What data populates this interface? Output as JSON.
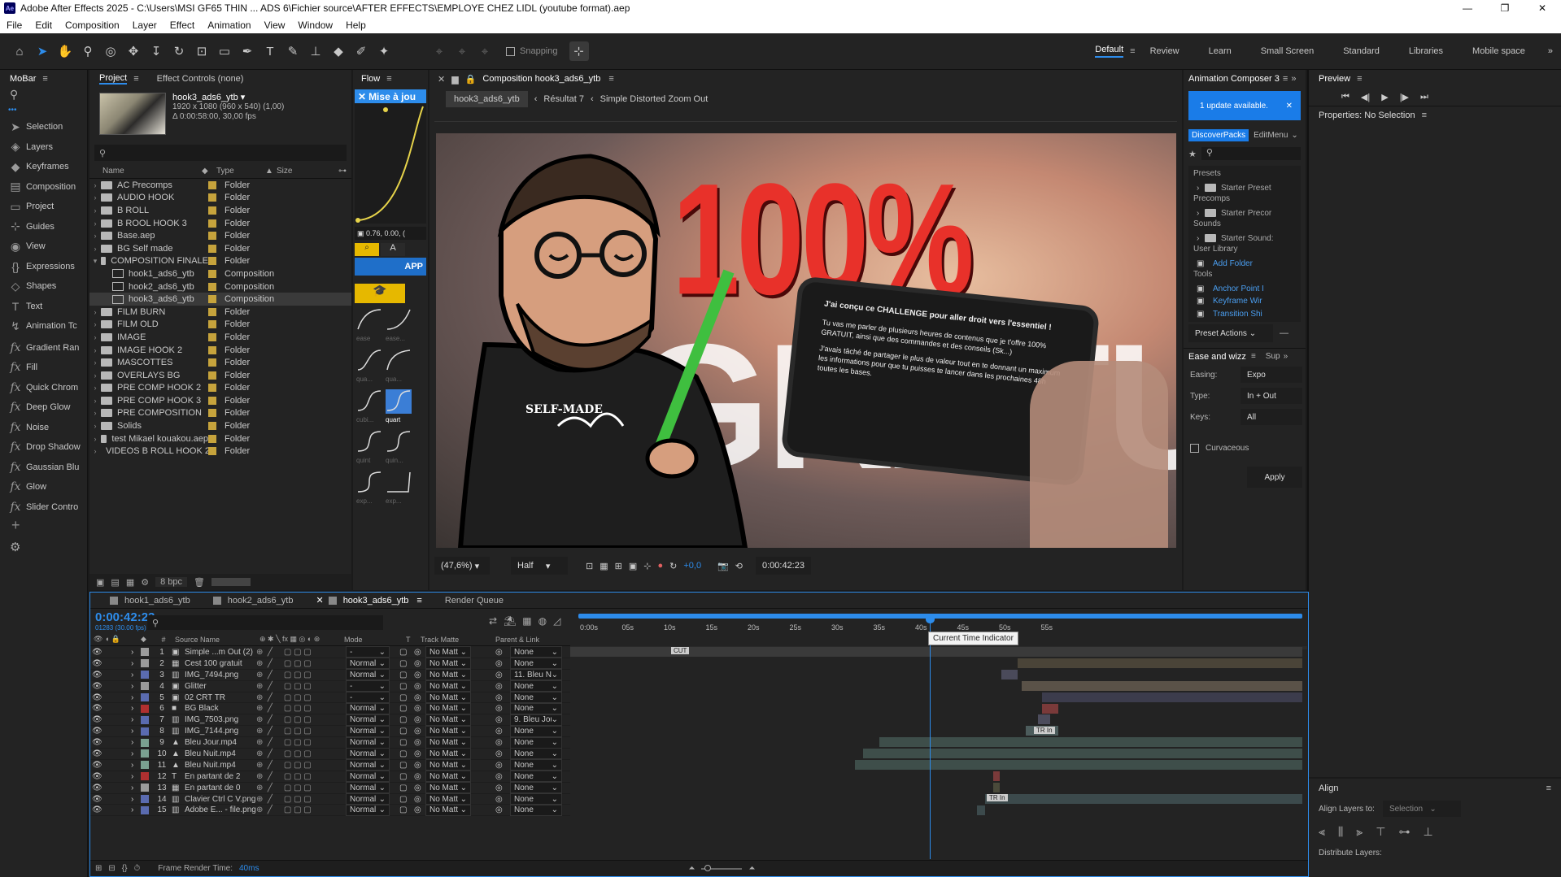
{
  "app": {
    "title": "Adobe After Effects 2025 - C:\\Users\\MSI GF65 THIN ... ADS 6\\Fichier source\\AFTER EFFECTS\\EMPLOYE CHEZ LIDL (youtube format).aep",
    "logo": "Ae"
  },
  "menu": [
    "File",
    "Edit",
    "Composition",
    "Layer",
    "Effect",
    "Animation",
    "View",
    "Window",
    "Help"
  ],
  "toolbar": {
    "snapping": "Snapping",
    "workspaces": [
      "Default",
      "Review",
      "Learn",
      "Small Screen",
      "Standard",
      "Libraries",
      "Mobile space"
    ]
  },
  "mobar": {
    "title": "MoBar",
    "items": [
      {
        "icon": "cursor-icon",
        "label": "Selection"
      },
      {
        "icon": "layers-icon",
        "label": "Layers"
      },
      {
        "icon": "keyframes-icon",
        "label": "Keyframes"
      },
      {
        "icon": "composition-icon",
        "label": "Composition"
      },
      {
        "icon": "project-icon",
        "label": "Project"
      },
      {
        "icon": "guides-icon",
        "label": "Guides"
      },
      {
        "icon": "eye-icon",
        "label": "View"
      },
      {
        "icon": "expressions-icon",
        "label": "Expressions"
      },
      {
        "icon": "shapes-icon",
        "label": "Shapes"
      },
      {
        "icon": "text-icon",
        "label": "Text"
      },
      {
        "icon": "animation-icon",
        "label": "Animation Tc"
      }
    ],
    "fx": [
      "Gradient Ran",
      "Fill",
      "Quick Chrom",
      "Deep Glow",
      "Noise",
      "Drop Shadow",
      "Gaussian Blu",
      "Glow",
      "Slider Contro"
    ]
  },
  "project": {
    "tab": "Project",
    "tab2": "Effect Controls (none)",
    "item_name": "hook3_ads6_ytb",
    "item_info1": "1920 x 1080  (960 x 540) (1,00)",
    "item_info2": "Δ 0:00:58:00, 30,00 fps",
    "headers": {
      "name": "Name",
      "type": "Type",
      "size": "Size"
    },
    "bpc": "8 bpc",
    "rows": [
      {
        "name": "AC Precomps",
        "type": "Folder",
        "indent": 0,
        "kind": "folder"
      },
      {
        "name": "AUDIO HOOK",
        "type": "Folder",
        "indent": 0,
        "kind": "folder"
      },
      {
        "name": "B ROLL",
        "type": "Folder",
        "indent": 0,
        "kind": "folder"
      },
      {
        "name": "B ROOL HOOK 3",
        "type": "Folder",
        "indent": 0,
        "kind": "folder"
      },
      {
        "name": "Base.aep",
        "type": "Folder",
        "indent": 0,
        "kind": "folder"
      },
      {
        "name": "BG Self made",
        "type": "Folder",
        "indent": 0,
        "kind": "folder"
      },
      {
        "name": "COMPOSITION FINALE",
        "type": "Folder",
        "indent": 0,
        "kind": "folder-open"
      },
      {
        "name": "hook1_ads6_ytb",
        "type": "Composition",
        "indent": 1,
        "kind": "comp"
      },
      {
        "name": "hook2_ads6_ytb",
        "type": "Composition",
        "indent": 1,
        "kind": "comp"
      },
      {
        "name": "hook3_ads6_ytb",
        "type": "Composition",
        "indent": 1,
        "kind": "comp",
        "selected": true
      },
      {
        "name": "FILM BURN",
        "type": "Folder",
        "indent": 0,
        "kind": "folder"
      },
      {
        "name": "FILM OLD",
        "type": "Folder",
        "indent": 0,
        "kind": "folder"
      },
      {
        "name": "IMAGE",
        "type": "Folder",
        "indent": 0,
        "kind": "folder"
      },
      {
        "name": "IMAGE HOOK 2",
        "type": "Folder",
        "indent": 0,
        "kind": "folder"
      },
      {
        "name": "MASCOTTES",
        "type": "Folder",
        "indent": 0,
        "kind": "folder"
      },
      {
        "name": "OVERLAYS BG",
        "type": "Folder",
        "indent": 0,
        "kind": "folder"
      },
      {
        "name": "PRE COMP HOOK 2",
        "type": "Folder",
        "indent": 0,
        "kind": "folder"
      },
      {
        "name": "PRE COMP HOOK 3",
        "type": "Folder",
        "indent": 0,
        "kind": "folder"
      },
      {
        "name": "PRE COMPOSITION",
        "type": "Folder",
        "indent": 0,
        "kind": "folder"
      },
      {
        "name": "Solids",
        "type": "Folder",
        "indent": 0,
        "kind": "folder"
      },
      {
        "name": "test Mikael kouakou.aep",
        "type": "Folder",
        "indent": 0,
        "kind": "folder"
      },
      {
        "name": "VIDEOS B ROLL HOOK 2",
        "type": "Folder",
        "indent": 0,
        "kind": "folder"
      }
    ]
  },
  "flow": {
    "tab": "Flow",
    "banner": "Mise à jou",
    "value": "0.76, 0.00, (",
    "app": "APP",
    "ease_labels": [
      "ease",
      "ease...",
      "qua...",
      "qua...",
      "cubi...",
      "quart",
      "quint",
      "quin...",
      "exp...",
      "exp..."
    ]
  },
  "viewer": {
    "tab": "Composition hook3_ads6_ytb",
    "crumbs": [
      "hook3_ads6_ytb",
      "Résultat 7",
      "Simple Distorted Zoom Out"
    ],
    "big_text": "100%",
    "overlay_text": "GRATUIT",
    "shirt": "SELF-MADE",
    "phone_text": "J'ai conçu ce CHALLENGE pour aller droit vers l'essentiel !",
    "phone_body": "Tu vas me parler de plusieurs heures de contenus que je t'offre 100% GRATUIT, ainsi que des commandes et des conseils (Sk...)",
    "phone_body2": "J'avais tâché de partager le plus de valeur tout en te donnant un maximum les informations pour que tu puisses te lancer dans les prochaines 48h toutes les bases.",
    "zoom": "(47,6%)",
    "res": "Half",
    "exposure": "+0,0",
    "timecode": "0:00:42:23"
  },
  "anim": {
    "tab": "Animation Composer 3",
    "update": "1 update available.",
    "subtabs": [
      "DiscoverPacks",
      "EditMenu"
    ],
    "sections": [
      {
        "title": "Presets",
        "items": [
          {
            "label": "Starter Preset",
            "type": "folder"
          }
        ]
      },
      {
        "title": "Precomps",
        "items": [
          {
            "label": "Starter Precor",
            "type": "folder"
          }
        ]
      },
      {
        "title": "Sounds",
        "items": [
          {
            "label": "Starter Sound:",
            "type": "folder"
          }
        ]
      },
      {
        "title": "User Library",
        "items": [
          {
            "label": "Add Folder",
            "type": "link"
          }
        ]
      },
      {
        "title": "Tools",
        "items": [
          {
            "label": "Anchor Point I",
            "type": "link"
          },
          {
            "label": "Keyframe Wir",
            "type": "link"
          },
          {
            "label": "Transition Shi",
            "type": "link"
          }
        ]
      }
    ],
    "preset_actions": "Preset Actions",
    "ease_tab": "Ease and wizz",
    "sup_tab": "Sup",
    "easing_label": "Easing:",
    "easing": "Expo",
    "type_label": "Type:",
    "type": "In + Out",
    "keys_label": "Keys:",
    "keys": "All",
    "curvaceous": "Curvaceous",
    "apply": "Apply"
  },
  "preview": {
    "tab": "Preview",
    "properties": "Properties: No Selection",
    "align_title": "Align",
    "align_layers_to": "Align Layers to:",
    "selection": "Selection",
    "distribute": "Distribute Layers:"
  },
  "timeline": {
    "tabs": [
      "hook1_ads6_ytb",
      "hook2_ads6_ytb",
      "hook3_ads6_ytb",
      "Render Queue"
    ],
    "timecode": "0:00:42:23",
    "frames": "01283 (30.00 fps)",
    "ruler": [
      "0:00s",
      "05s",
      "10s",
      "15s",
      "20s",
      "25s",
      "30s",
      "35s",
      "40s",
      "45s",
      "50s",
      "55s"
    ],
    "headers": {
      "num": "#",
      "src": "Source Name",
      "mode": "Mode",
      "t": "T",
      "matte": "Track Matte",
      "parent": "Parent & Link"
    },
    "tooltip": "Current Time Indicator",
    "cut": "CUT",
    "trin": "TR In",
    "render_time_label": "Frame Render Time:",
    "render_time": "40ms",
    "layers": [
      {
        "n": "1",
        "name": "Simple ...m Out (2)",
        "mode": "-",
        "matte": "No Matt",
        "parent": "None",
        "color": "#9b9b9b",
        "icon": "adj"
      },
      {
        "n": "2",
        "name": "Cest 100 gratuit",
        "mode": "Normal",
        "matte": "No Matt",
        "parent": "None",
        "color": "#9b9b9b",
        "icon": "comp"
      },
      {
        "n": "3",
        "name": "IMG_7494.png",
        "mode": "Normal",
        "matte": "No Matt",
        "parent": "11. Bleu Nu",
        "color": "#5a6bb0",
        "icon": "img"
      },
      {
        "n": "4",
        "name": "Glitter",
        "mode": "-",
        "matte": "No Matt",
        "parent": "None",
        "color": "#9b9b9b",
        "icon": "adj"
      },
      {
        "n": "5",
        "name": "02 CRT TR",
        "mode": "-",
        "matte": "No Matt",
        "parent": "None",
        "color": "#5a6bb0",
        "icon": "adj"
      },
      {
        "n": "6",
        "name": "BG Black",
        "mode": "Normal",
        "matte": "No Matt",
        "parent": "None",
        "color": "#b03030",
        "icon": "solid"
      },
      {
        "n": "7",
        "name": "IMG_7503.png",
        "mode": "Normal",
        "matte": "No Matt",
        "parent": "9. Bleu Jour.",
        "color": "#5a6bb0",
        "icon": "img"
      },
      {
        "n": "8",
        "name": "IMG_7144.png",
        "mode": "Normal",
        "matte": "No Matt",
        "parent": "None",
        "color": "#5a6bb0",
        "icon": "img"
      },
      {
        "n": "9",
        "name": "Bleu Jour.mp4",
        "mode": "Normal",
        "matte": "No Matt",
        "parent": "None",
        "color": "#7aa090",
        "icon": "video"
      },
      {
        "n": "10",
        "name": "Bleu Nuit.mp4",
        "mode": "Normal",
        "matte": "No Matt",
        "parent": "None",
        "color": "#7aa090",
        "icon": "video"
      },
      {
        "n": "11",
        "name": "Bleu Nuit.mp4",
        "mode": "Normal",
        "matte": "No Matt",
        "parent": "None",
        "color": "#7aa090",
        "icon": "video"
      },
      {
        "n": "12",
        "name": "En partant de 2",
        "mode": "Normal",
        "matte": "No Matt",
        "parent": "None",
        "color": "#b03030",
        "icon": "text"
      },
      {
        "n": "13",
        "name": "En partant de 0",
        "mode": "Normal",
        "matte": "No Matt",
        "parent": "None",
        "color": "#9b9b9b",
        "icon": "comp"
      },
      {
        "n": "14",
        "name": "Clavier Ctrl C V.png",
        "mode": "Normal",
        "matte": "No Matt",
        "parent": "None",
        "color": "#5a6bb0",
        "icon": "img"
      },
      {
        "n": "15",
        "name": "Adobe E... - file.png",
        "mode": "Normal",
        "matte": "No Matt",
        "parent": "None",
        "color": "#5a6bb0",
        "icon": "img"
      }
    ]
  }
}
